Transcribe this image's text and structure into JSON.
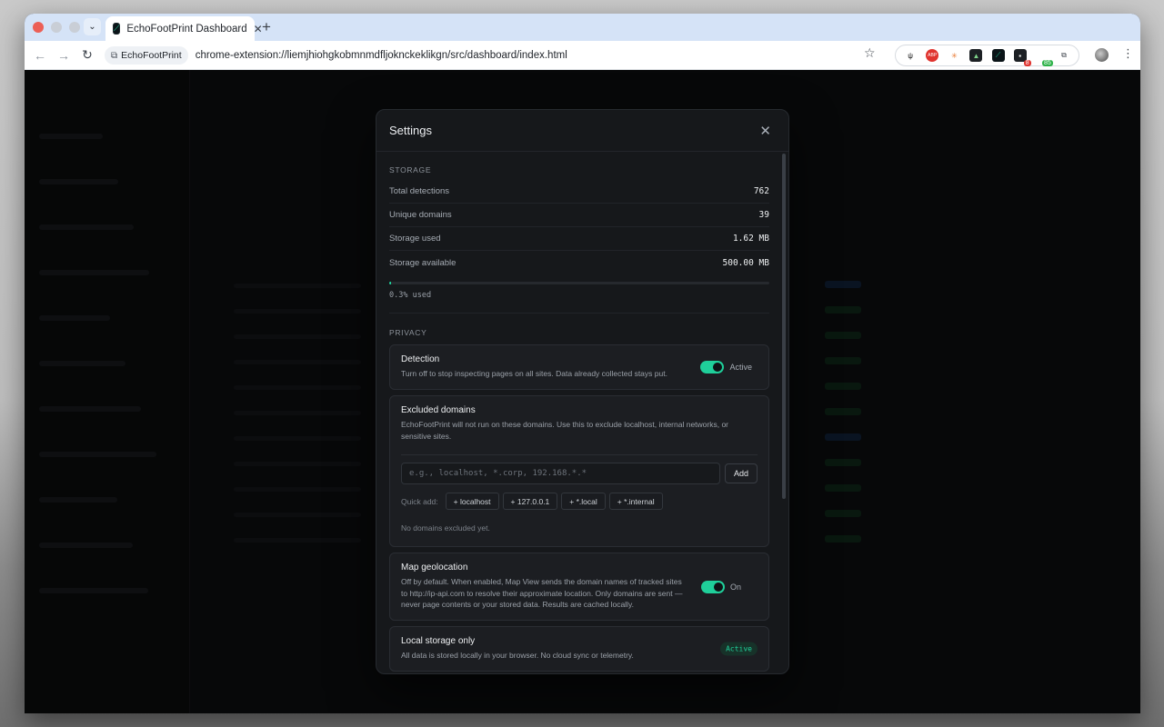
{
  "browser": {
    "tab_title": "EchoFootPrint Dashboard",
    "tab_close": "✕",
    "new_tab": "+",
    "site_chip": "EchoFootPrint",
    "url": "chrome-extension://liemjhiohgkobmnmdfljoknckeklikgn/src/dashboard/index.html",
    "extensions": [
      {
        "name": "fork-knife-extension",
        "glyph": "ψ",
        "bg": "#ffffff",
        "fg": "#111111",
        "badge": ""
      },
      {
        "name": "adblock-extension",
        "glyph": "ABP",
        "bg": "#e0342f",
        "fg": "#ffffff",
        "badge": ""
      },
      {
        "name": "sun-extension",
        "glyph": "✳",
        "bg": "#ffffff",
        "fg": "#e8772e",
        "badge": ""
      },
      {
        "name": "dark-app-extension",
        "glyph": "▲",
        "bg": "#1c2024",
        "fg": "#7fd58b",
        "badge": ""
      },
      {
        "name": "echofootprint-extension",
        "glyph": "⟋",
        "bg": "#0b1418",
        "fg": "#1fcf9a",
        "badge": ""
      },
      {
        "name": "counter-extension",
        "glyph": "▪",
        "bg": "#1c2024",
        "fg": "#ffffff",
        "badge": "8",
        "badge_bg": "#e0342f"
      },
      {
        "name": "green-badge-extension",
        "glyph": "",
        "bg": "#ffffff",
        "fg": "#ffffff",
        "badge": "85",
        "badge_bg": "#2fb34a"
      },
      {
        "name": "puzzle-extension",
        "glyph": "⧉",
        "bg": "#ffffff",
        "fg": "#3d434b",
        "badge": ""
      }
    ]
  },
  "modal": {
    "title": "Settings",
    "close": "✕",
    "storage": {
      "label": "STORAGE",
      "rows": [
        {
          "label": "Total detections",
          "value": "762"
        },
        {
          "label": "Unique domains",
          "value": "39"
        },
        {
          "label": "Storage used",
          "value": "1.62 MB"
        },
        {
          "label": "Storage available",
          "value": "500.00 MB"
        }
      ],
      "used_fraction": 0.003,
      "used_label": "0.3% used"
    },
    "privacy": {
      "label": "PRIVACY",
      "detection": {
        "title": "Detection",
        "desc": "Turn off to stop inspecting pages on all sites. Data already collected stays put.",
        "toggle_label": "Active"
      },
      "excluded": {
        "title": "Excluded domains",
        "desc": "EchoFootPrint will not run on these domains. Use this to exclude localhost, internal networks, or sensitive sites.",
        "placeholder": "e.g., localhost, *.corp, 192.168.*.*",
        "value": "",
        "add_label": "Add",
        "quick_label": "Quick add:",
        "quick": [
          "+ localhost",
          "+ 127.0.0.1",
          "+ *.local",
          "+ *.internal"
        ],
        "empty": "No domains excluded yet."
      },
      "geo": {
        "title": "Map geolocation",
        "desc": "Off by default. When enabled, Map View sends the domain names of tracked sites to http://ip-api.com to resolve their approximate location. Only domains are sent — never page contents or your stored data. Results are cached locally.",
        "toggle_label": "On"
      },
      "local": {
        "title": "Local storage only",
        "desc": "All data is stored locally in your browser. No cloud sync or telemetry.",
        "badge": "Active"
      }
    }
  }
}
